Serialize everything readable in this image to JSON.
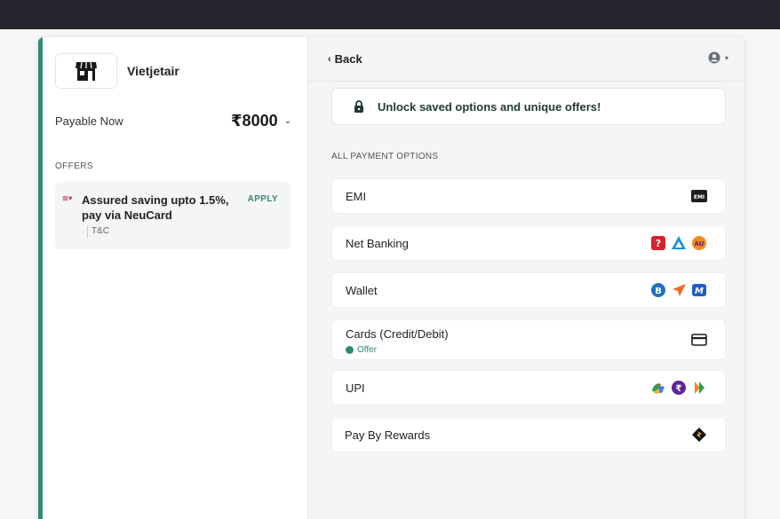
{
  "merchant": {
    "name": "Vietjetair",
    "logo_icon": "storefront-icon"
  },
  "payable": {
    "label": "Payable Now",
    "amount": "₹8000"
  },
  "offers": {
    "heading": "OFFERS",
    "items": [
      {
        "text": "Assured saving upto 1.5%, pay via NeuCard",
        "action": "APPLY",
        "terms": "T&C"
      }
    ]
  },
  "header": {
    "back_label": "Back",
    "account_icon": "user-circle-icon"
  },
  "unlock": {
    "text": "Unlock saved options and unique offers!",
    "icon": "lock-icon"
  },
  "payment": {
    "heading": "ALL PAYMENT OPTIONS",
    "options": [
      {
        "label": "EMI",
        "icons": [
          "emi-icon"
        ]
      },
      {
        "label": "Net Banking",
        "icons": [
          "bank-red-icon",
          "bank-blue-icon",
          "au-bank-icon"
        ]
      },
      {
        "label": "Wallet",
        "icons": [
          "wallet-b-icon",
          "wallet-arrow-icon",
          "wallet-m-icon"
        ]
      },
      {
        "label": "Cards (Credit/Debit)",
        "sub": "Offer",
        "icons": [
          "card-icon"
        ]
      },
      {
        "label": "UPI",
        "icons": [
          "upi-gpay-icon",
          "upi-phonepe-icon",
          "upi-bhim-icon"
        ]
      },
      {
        "label": "Pay By Rewards",
        "icons": [
          "rewards-icon"
        ]
      }
    ]
  },
  "colors": {
    "accent": "#2e8c73",
    "topbar": "#262630"
  }
}
